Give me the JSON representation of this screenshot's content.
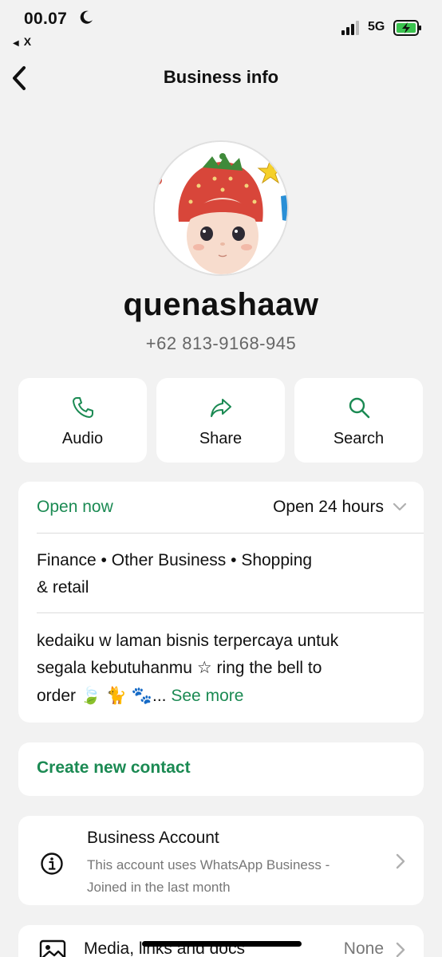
{
  "status_bar": {
    "time": "00.07",
    "back_app": "X",
    "network": "5G"
  },
  "nav": {
    "title": "Business info"
  },
  "profile": {
    "name": "quenashaaw",
    "phone": "+62 813-9168-945"
  },
  "actions": [
    {
      "label": "Audio",
      "icon": "phone-icon"
    },
    {
      "label": "Share",
      "icon": "share-arrow-icon"
    },
    {
      "label": "Search",
      "icon": "search-icon"
    }
  ],
  "business_card": {
    "open_status": "Open now",
    "hours": "Open 24 hours",
    "categories_line1": "Finance • Other Business • Shopping",
    "categories_line2": "& retail",
    "description_line1": "kedaiku w laman bisnis terpercaya untuk",
    "description_line2": "segala kebutuhanmu ☆ ring the bell to",
    "description_line3_prefix": "order ",
    "emoji_leaf": "🍃",
    "emoji_cat": "🐈",
    "emoji_paws": "🐾",
    "ellipsis": "...",
    "see_more": "See more"
  },
  "create_contact": {
    "label": "Create new contact"
  },
  "business_account": {
    "title": "Business Account",
    "desc_line1": "This account uses WhatsApp Business -",
    "desc_line2": "Joined in the last month",
    "icon": "info-icon"
  },
  "media": {
    "label": "Media, links and docs",
    "value": "None",
    "icon": "photo-icon"
  },
  "colors": {
    "accent_green": "#1b8a53",
    "background": "#f2f2f2",
    "card": "#ffffff",
    "battery_green": "#3ac34f"
  }
}
